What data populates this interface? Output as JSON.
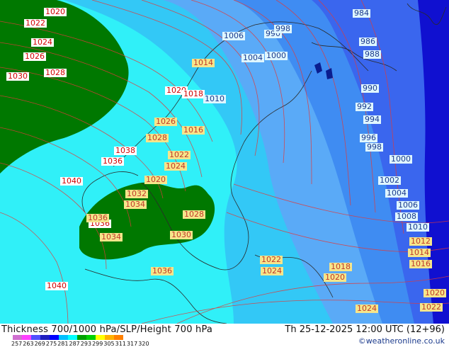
{
  "footer": {
    "title": "Thickness 700/1000 hPa/SLP/Height 700 hPa",
    "valid": "Th 25-12-2025 12:00 UTC (12+96)",
    "credit": "©weatheronline.co.uk",
    "scale_ticks": [
      "257",
      "263",
      "269",
      "275",
      "281",
      "287",
      "293",
      "299",
      "305",
      "311",
      "317",
      "320"
    ],
    "scale_colors": [
      "#d070d0",
      "#ff40ff",
      "#5050ff",
      "#2020c0",
      "#0000ff",
      "#00c0ff",
      "#00ffff",
      "#00a000",
      "#00d000",
      "#ffff00",
      "#ffb000",
      "#ff8000"
    ]
  },
  "colors": {
    "dark_blue": "#1010d0",
    "mid_blue": "#3a66ee",
    "blue": "#3f8cf2",
    "light_blue": "#5aaaf7",
    "sky": "#33c8f6",
    "cyan": "#30f0f8",
    "green": "#007800",
    "isobar": "#e03a3a"
  },
  "pressure_labels": [
    {
      "text": "1020",
      "style": "w"
    },
    {
      "text": "1022",
      "style": "w"
    },
    {
      "text": "1024",
      "style": "w"
    },
    {
      "text": "1026",
      "style": "w"
    },
    {
      "text": "1028",
      "style": "w"
    },
    {
      "text": "1030",
      "style": "w"
    },
    {
      "text": "1040",
      "style": "w"
    },
    {
      "text": "1040",
      "style": "w"
    },
    {
      "text": "1036",
      "style": "w"
    },
    {
      "text": "1036",
      "style": "w"
    },
    {
      "text": "1038",
      "style": "w"
    },
    {
      "text": "1020",
      "style": "w"
    },
    {
      "text": "1018",
      "style": "w"
    },
    {
      "text": "984",
      "style": "b"
    },
    {
      "text": "986",
      "style": "b"
    },
    {
      "text": "988",
      "style": "b"
    },
    {
      "text": "990",
      "style": "b"
    },
    {
      "text": "992",
      "style": "b"
    },
    {
      "text": "994",
      "style": "b"
    },
    {
      "text": "996",
      "style": "b"
    },
    {
      "text": "998",
      "style": "b"
    },
    {
      "text": "1000",
      "style": "b"
    },
    {
      "text": "1002",
      "style": "b"
    },
    {
      "text": "1004",
      "style": "b"
    },
    {
      "text": "1006",
      "style": "b"
    },
    {
      "text": "1008",
      "style": "b"
    },
    {
      "text": "1010",
      "style": "b"
    },
    {
      "text": "1012",
      "style": "y"
    },
    {
      "text": "1014",
      "style": "y"
    },
    {
      "text": "1016",
      "style": "y"
    },
    {
      "text": "1018",
      "style": "y"
    },
    {
      "text": "1020",
      "style": "y"
    },
    {
      "text": "1022",
      "style": "y"
    },
    {
      "text": "1024",
      "style": "y"
    },
    {
      "text": "1020",
      "style": "y"
    },
    {
      "text": "1022",
      "style": "y"
    },
    {
      "text": "1006",
      "style": "b"
    },
    {
      "text": "990",
      "style": "b"
    },
    {
      "text": "998",
      "style": "b"
    },
    {
      "text": "1004",
      "style": "b"
    },
    {
      "text": "1000",
      "style": "b"
    },
    {
      "text": "1014",
      "style": "y"
    },
    {
      "text": "1010",
      "style": "b"
    },
    {
      "text": "1016",
      "style": "y"
    },
    {
      "text": "1026",
      "style": "y"
    },
    {
      "text": "1028",
      "style": "y"
    },
    {
      "text": "1022",
      "style": "y"
    },
    {
      "text": "1024",
      "style": "y"
    },
    {
      "text": "1020",
      "style": "y"
    },
    {
      "text": "1032",
      "style": "y"
    },
    {
      "text": "1034",
      "style": "y"
    },
    {
      "text": "1036",
      "style": "y"
    },
    {
      "text": "1034",
      "style": "y"
    },
    {
      "text": "1028",
      "style": "y"
    },
    {
      "text": "1030",
      "style": "y"
    },
    {
      "text": "1036",
      "style": "y"
    },
    {
      "text": "1022",
      "style": "y"
    },
    {
      "text": "1024",
      "style": "y"
    }
  ]
}
